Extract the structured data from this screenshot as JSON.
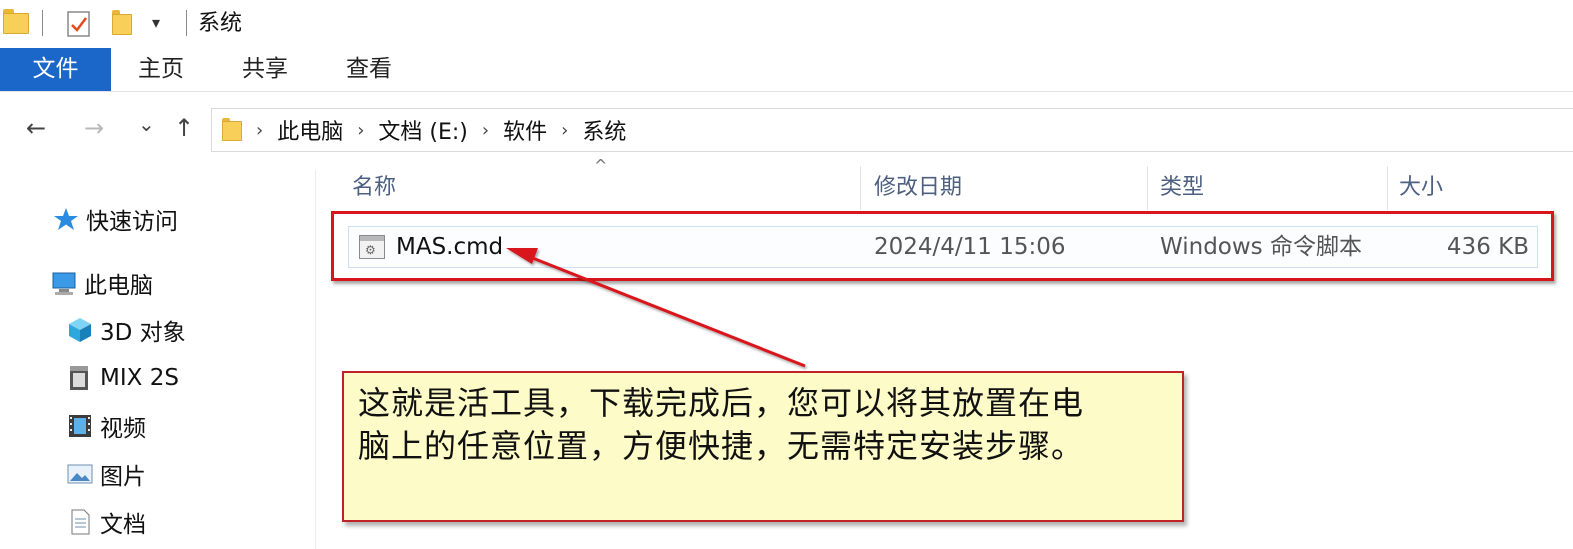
{
  "window": {
    "title": "系统"
  },
  "quick_access_toolbar": {
    "icons": [
      "folder-icon",
      "properties-checklist-icon",
      "new-folder-icon",
      "customize-dropdown-icon"
    ]
  },
  "ribbon": {
    "tabs": [
      {
        "label": "文件",
        "active": true
      },
      {
        "label": "主页"
      },
      {
        "label": "共享"
      },
      {
        "label": "查看"
      }
    ]
  },
  "navigation": {
    "back_icon": "←",
    "forward_icon": "→",
    "recent_icon": "⌄",
    "up_icon": "↑",
    "breadcrumb": [
      "此电脑",
      "文档 (E:)",
      "软件",
      "系统"
    ],
    "breadcrumb_separator": "›"
  },
  "sidebar": {
    "items": [
      {
        "label": "快速访问",
        "icon": "star-icon"
      },
      {
        "label": "此电脑",
        "icon": "computer-icon"
      },
      {
        "label": "3D 对象",
        "icon": "cube-3d-icon"
      },
      {
        "label": "MIX 2S",
        "icon": "phone-device-icon"
      },
      {
        "label": "视频",
        "icon": "film-icon"
      },
      {
        "label": "图片",
        "icon": "picture-icon"
      },
      {
        "label": "文档",
        "icon": "document-icon"
      }
    ]
  },
  "file_list": {
    "columns": [
      "名称",
      "修改日期",
      "类型",
      "大小"
    ],
    "sort_indicator": "^",
    "rows": [
      {
        "name": "MAS.cmd",
        "modified": "2024/4/11 15:06",
        "type": "Windows 命令脚本",
        "size": "436 KB",
        "icon": "cmd-script-icon"
      }
    ]
  },
  "annotation": {
    "color": "#d8151b",
    "callout_bg": "#fdfcc8",
    "lines": [
      "这就是活工具，下载完成后，您可以将其放置在电",
      "脑上的任意位置，方便快捷，无需特定安装步骤。"
    ]
  },
  "colors": {
    "ribbon_file_tab": "#1b66c9",
    "column_header_text": "#4d6082",
    "folder_yellow": "#f8cf58"
  }
}
